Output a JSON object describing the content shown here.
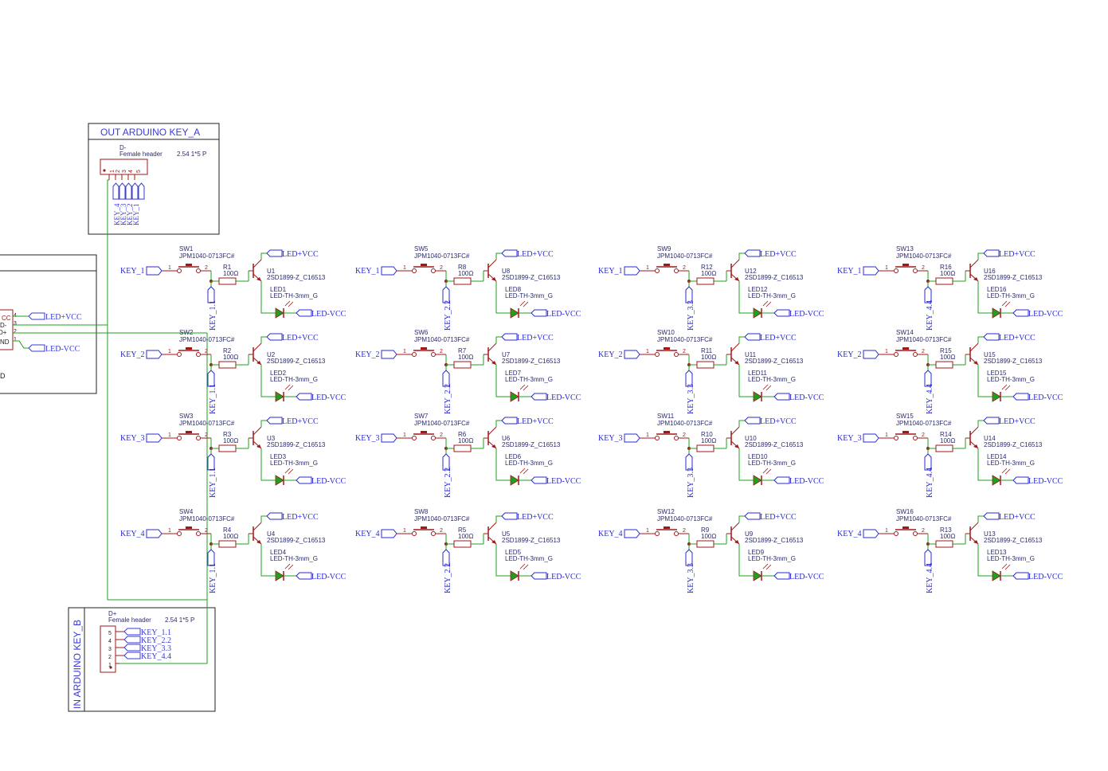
{
  "colors": {
    "wire": "#1ea01e",
    "part": "#a01818",
    "net": "#2a2ad0",
    "text": "#2a2a6e",
    "frame": "#202020",
    "led": "#1ea01e"
  },
  "out_block": {
    "title": "OUT ARDUINO KEY_A",
    "designator": "D-",
    "part": "Female header",
    "size": "2.54 1*5 P",
    "pins": [
      "1",
      "2",
      "3",
      "4",
      "5"
    ],
    "nets": [
      "KEY_4",
      "KEY_3",
      "KEY_2",
      "KEY_1"
    ]
  },
  "in_block": {
    "title": "IN ARDUINO KEY_B",
    "designator": "D+",
    "part": "Female header",
    "size": "2.54 1*5 P",
    "pins": [
      "5",
      "4",
      "3",
      "2",
      "1"
    ],
    "nets": [
      "KEY_1.1",
      "KEY_2.2",
      "KEY_3.3",
      "KEY_4.4"
    ]
  },
  "usb_block": {
    "pins": [
      "CC",
      "D-",
      "D+",
      "ND",
      "D"
    ],
    "pin_numbers": [
      "4",
      "3",
      "2",
      "1"
    ],
    "nets": [
      "LED+VCC",
      "LED-VCC"
    ]
  },
  "power_nets": {
    "pos": "LED+VCC",
    "neg": "LED-VCC"
  },
  "switch_part": "JPM1040-0713FC#",
  "resistor_value": "100Ω",
  "transistor_part": "2SD1899-Z_C16513",
  "led_part": "LED-TH-3mm_G",
  "pin1": "1",
  "pin2": "2",
  "columns": [
    {
      "col_net": "KEY_1.1",
      "cells": [
        {
          "row_net": "KEY_1",
          "sw": "SW1",
          "r": "R1",
          "u": "U1",
          "led": "LED1"
        },
        {
          "row_net": "KEY_2",
          "sw": "SW2",
          "r": "R2",
          "u": "U2",
          "led": "LED2"
        },
        {
          "row_net": "KEY_3",
          "sw": "SW3",
          "r": "R3",
          "u": "U3",
          "led": "LED3"
        },
        {
          "row_net": "KEY_4",
          "sw": "SW4",
          "r": "R4",
          "u": "U4",
          "led": "LED4"
        }
      ]
    },
    {
      "col_net": "KEY_2.2",
      "cells": [
        {
          "row_net": "KEY_1",
          "sw": "SW5",
          "r": "R8",
          "u": "U8",
          "led": "LED8"
        },
        {
          "row_net": "KEY_2",
          "sw": "SW6",
          "r": "R7",
          "u": "U7",
          "led": "LED7"
        },
        {
          "row_net": "KEY_3",
          "sw": "SW7",
          "r": "R6",
          "u": "U6",
          "led": "LED6"
        },
        {
          "row_net": "KEY_4",
          "sw": "SW8",
          "r": "R5",
          "u": "U5",
          "led": "LED5"
        }
      ]
    },
    {
      "col_net": "KEY_3.3",
      "cells": [
        {
          "row_net": "KEY_1",
          "sw": "SW9",
          "r": "R12",
          "u": "U12",
          "led": "LED12"
        },
        {
          "row_net": "KEY_2",
          "sw": "SW10",
          "r": "R11",
          "u": "U11",
          "led": "LED11"
        },
        {
          "row_net": "KEY_3",
          "sw": "SW11",
          "r": "R10",
          "u": "U10",
          "led": "LED10"
        },
        {
          "row_net": "KEY_4",
          "sw": "SW12",
          "r": "R9",
          "u": "U9",
          "led": "LED9"
        }
      ]
    },
    {
      "col_net": "KEY_4.4",
      "cells": [
        {
          "row_net": "KEY_1",
          "sw": "SW13",
          "r": "R16",
          "u": "U16",
          "led": "LED16"
        },
        {
          "row_net": "KEY_2",
          "sw": "SW14",
          "r": "R15",
          "u": "U15",
          "led": "LED15"
        },
        {
          "row_net": "KEY_3",
          "sw": "SW15",
          "r": "R14",
          "u": "U14",
          "led": "LED14"
        },
        {
          "row_net": "KEY_4",
          "sw": "SW16",
          "r": "R13",
          "u": "U13",
          "led": "LED13"
        }
      ]
    }
  ]
}
